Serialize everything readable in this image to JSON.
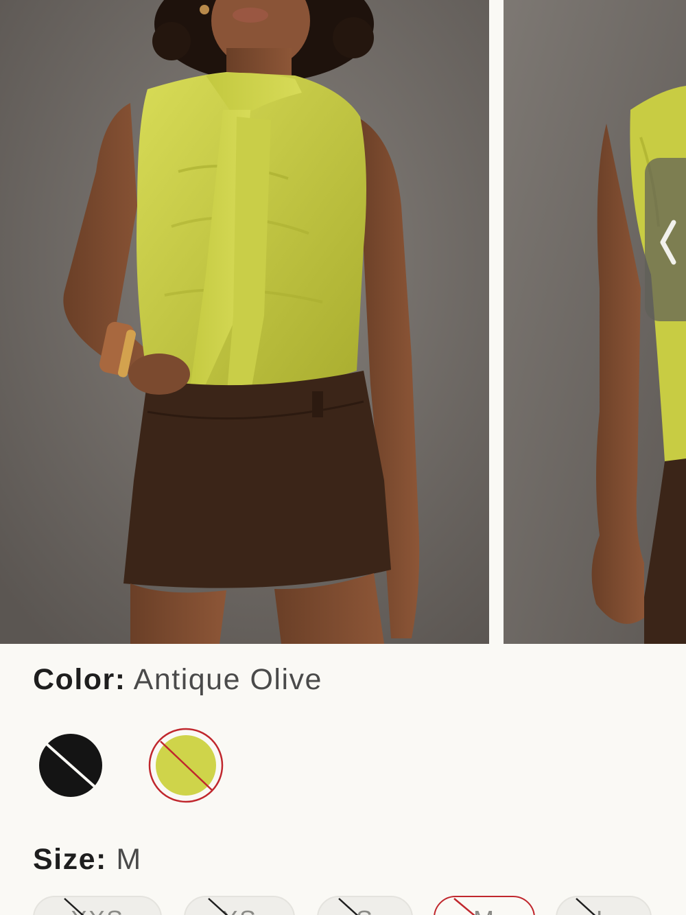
{
  "gallery": {
    "next_arrow_icon": "chevron-left-icon"
  },
  "color": {
    "label": "Color:",
    "value": "Antique Olive",
    "swatches": [
      {
        "name": "black",
        "hex": "#141414",
        "available": true
      },
      {
        "name": "antique-olive",
        "hex": "#cfd44a",
        "available": false,
        "selected": true
      }
    ]
  },
  "size": {
    "label": "Size:",
    "value": "M",
    "options": [
      {
        "label": "XXS",
        "available": false
      },
      {
        "label": "XS",
        "available": false
      },
      {
        "label": "S",
        "available": false
      },
      {
        "label": "M",
        "available": false,
        "selected": true
      },
      {
        "label": "L",
        "available": false
      }
    ]
  },
  "colors": {
    "accent_red": "#c0272d",
    "olive": "#cfd44a",
    "skirt_brown": "#3b2518",
    "backdrop": "#6f6a66"
  }
}
